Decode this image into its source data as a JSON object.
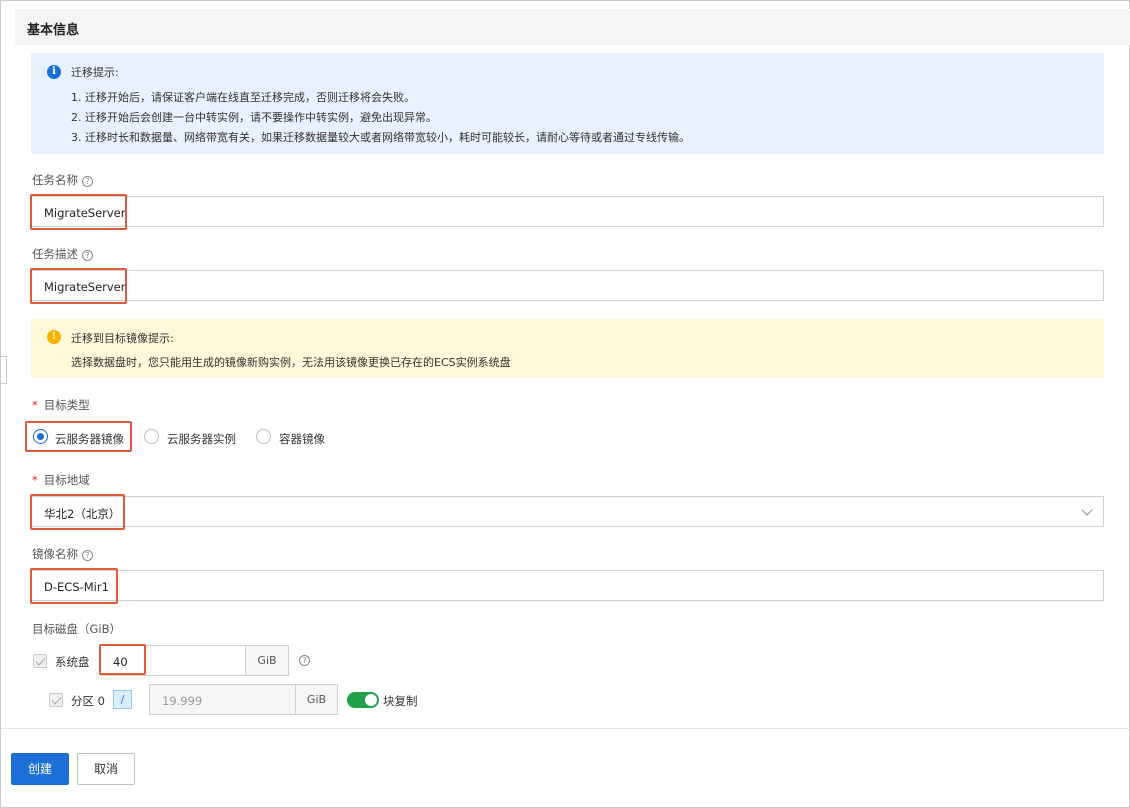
{
  "section_title": "基本信息",
  "migration_tip": {
    "title": "迁移提示:",
    "lines": [
      "1. 迁移开始后，请保证客户端在线直至迁移完成，否则迁移将会失败。",
      "2. 迁移开始后会创建一台中转实例，请不要操作中转实例，避免出现异常。",
      "3. 迁移时长和数据量、网络带宽有关，如果迁移数据量较大或者网络带宽较小，耗时可能较长，请耐心等待或者通过专线传输。"
    ]
  },
  "task_name": {
    "label": "任务名称",
    "value": "MigrateServer"
  },
  "task_desc": {
    "label": "任务描述",
    "value": "MigrateServer"
  },
  "image_tip": {
    "title": "迁移到目标镜像提示:",
    "line": "选择数据盘时，您只能用生成的镜像新购实例，无法用该镜像更换已存在的ECS实例系统盘"
  },
  "target_type": {
    "label": "目标类型",
    "options": [
      "云服务器镜像",
      "云服务器实例",
      "容器镜像"
    ],
    "selected": "云服务器镜像"
  },
  "target_region": {
    "label": "目标地域",
    "value": "华北2（北京）"
  },
  "image_name": {
    "label": "镜像名称",
    "value": "D-ECS-Mir1"
  },
  "target_disk": {
    "label": "目标磁盘（GiB）",
    "system_disk_label": "系统盘",
    "system_disk_value": "40",
    "unit": "GiB",
    "partition_label": "分区 0",
    "partition_path": "/",
    "partition_value": "19.999",
    "block_copy_label": "块复制",
    "block_copy_on": true
  },
  "buttons": {
    "create": "创建",
    "cancel": "取消"
  },
  "colors": {
    "primary": "#1c6fd6",
    "highlight": "#e05a3a",
    "toggle_on": "#21a04a"
  }
}
